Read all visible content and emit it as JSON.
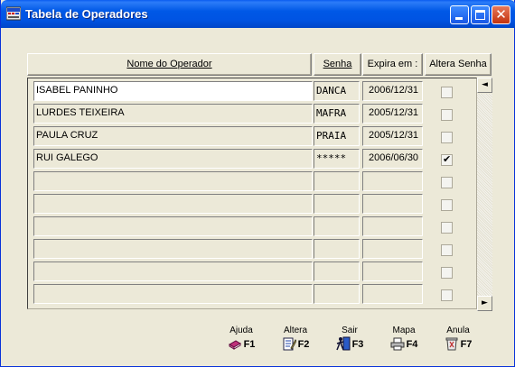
{
  "window": {
    "title": "Tabela de Operadores"
  },
  "headers": {
    "nome": "Nome do Operador",
    "senha": "Senha",
    "expira": "Expira em :",
    "altera": "Altera Senha"
  },
  "rows": [
    {
      "nome": "ISABEL PANINHO",
      "senha": "DANCA",
      "expira": "2006/12/31",
      "altera": false
    },
    {
      "nome": "LURDES TEIXEIRA",
      "senha": "MAFRA",
      "expira": "2005/12/31",
      "altera": false
    },
    {
      "nome": "PAULA CRUZ",
      "senha": "PRAIA",
      "expira": "2005/12/31",
      "altera": false
    },
    {
      "nome": "RUI GALEGO",
      "senha": "*****",
      "expira": "2006/06/30",
      "altera": true
    },
    {
      "nome": "",
      "senha": "",
      "expira": "",
      "altera": false
    },
    {
      "nome": "",
      "senha": "",
      "expira": "",
      "altera": false
    },
    {
      "nome": "",
      "senha": "",
      "expira": "",
      "altera": false
    },
    {
      "nome": "",
      "senha": "",
      "expira": "",
      "altera": false
    },
    {
      "nome": "",
      "senha": "",
      "expira": "",
      "altera": false
    },
    {
      "nome": "",
      "senha": "",
      "expira": "",
      "altera": false
    }
  ],
  "scroll": {
    "up": "◄",
    "down": "►"
  },
  "fkeys": [
    {
      "label": "Ajuda",
      "key": "F1",
      "icon": "help-book-icon"
    },
    {
      "label": "Altera",
      "key": "F2",
      "icon": "edit-document-icon"
    },
    {
      "label": "Sair",
      "key": "F3",
      "icon": "exit-door-icon"
    },
    {
      "label": "Mapa",
      "key": "F4",
      "icon": "printer-icon"
    },
    {
      "label": "Anula",
      "key": "F7",
      "icon": "trash-bin-icon"
    }
  ],
  "colors": {
    "titlebar": "#0054E3",
    "window_bg": "#ECE9D8",
    "active_cell": "#FFFFFF"
  }
}
